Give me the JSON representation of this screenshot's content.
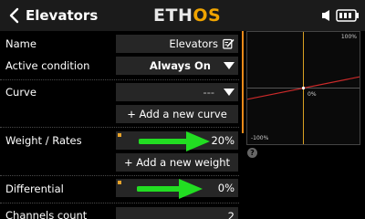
{
  "header": {
    "title": "Elevators",
    "logo_white": "ETH",
    "logo_orange": "OS"
  },
  "rows": {
    "name": {
      "label": "Name",
      "value": "Elevators"
    },
    "active_condition": {
      "label": "Active condition",
      "value": "Always On"
    },
    "curve": {
      "label": "Curve",
      "value": "---"
    },
    "add_curve": {
      "label": "+ Add a new curve"
    },
    "weight": {
      "label": "Weight / Rates",
      "value": "20%"
    },
    "add_weight": {
      "label": "+ Add a new weight"
    },
    "differential": {
      "label": "Differential",
      "value": "0%"
    },
    "channels_count": {
      "label": "Channels count",
      "value": "2"
    }
  },
  "graph": {
    "top_label": "100%",
    "center_label": "0%",
    "bottom_label": "-100%",
    "weight_fraction": 0.2
  },
  "colors": {
    "accent": "#f0a400",
    "arrow": "#22dd22",
    "curve_line": "#cc2a2a"
  },
  "icons": {
    "back": "chevron-left-icon",
    "sound": "speaker-icon",
    "battery": "battery-icon",
    "edit": "edit-icon",
    "dropdown": "chevron-down-icon",
    "help": "help-icon"
  },
  "help_label": "?"
}
